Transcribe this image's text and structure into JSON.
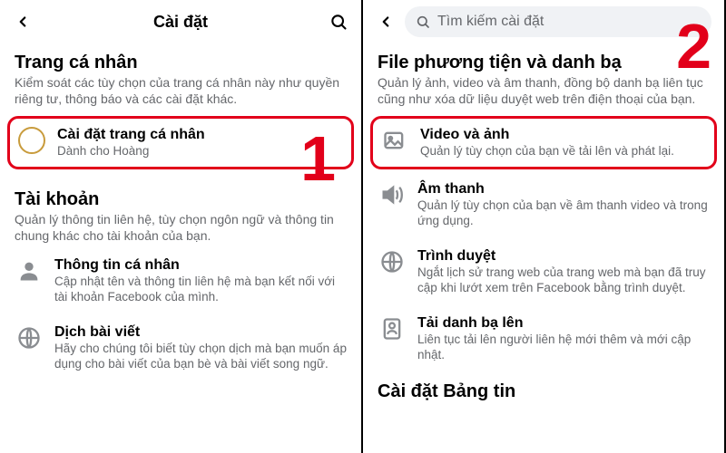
{
  "left": {
    "header_title": "Cài đặt",
    "section1": {
      "title": "Trang cá nhân",
      "desc": "Kiểm soát các tùy chọn của trang cá nhân này như quyền riêng tư, thông báo và các cài đặt khác."
    },
    "profile_row": {
      "title": "Cài đặt trang cá nhân",
      "sub": "Dành cho Hoàng"
    },
    "section2": {
      "title": "Tài khoản",
      "desc": "Quản lý thông tin liên hệ, tùy chọn ngôn ngữ và thông tin chung khác cho tài khoản của bạn."
    },
    "rows": [
      {
        "title": "Thông tin cá nhân",
        "sub": "Cập nhật tên và thông tin liên hệ mà bạn kết nối với tài khoản Facebook của mình."
      },
      {
        "title": "Dịch bài viết",
        "sub": "Hãy cho chúng tôi biết tùy chọn dịch mà bạn muốn áp dụng cho bài viết của bạn bè và bài viết song ngữ."
      }
    ],
    "num": "1"
  },
  "right": {
    "search_placeholder": "Tìm kiếm cài đặt",
    "section": {
      "title": "File phương tiện và danh bạ",
      "desc": "Quản lý ảnh, video và âm thanh, đồng bộ danh bạ liên tục cũng như xóa dữ liệu duyệt web trên điện thoại của bạn."
    },
    "rows": [
      {
        "title": "Video và ảnh",
        "sub": "Quản lý tùy chọn của bạn về tải lên và phát lại."
      },
      {
        "title": "Âm thanh",
        "sub": "Quản lý tùy chọn của bạn về âm thanh video và trong ứng dụng."
      },
      {
        "title": "Trình duyệt",
        "sub": "Ngắt lịch sử trang web của trang web mà bạn đã truy cập khi lướt xem trên Facebook bằng trình duyệt."
      },
      {
        "title": "Tải danh bạ lên",
        "sub": "Liên tục tải lên người liên hệ mới thêm và mới cập nhật."
      }
    ],
    "section2_title": "Cài đặt Bảng tin",
    "num": "2"
  }
}
